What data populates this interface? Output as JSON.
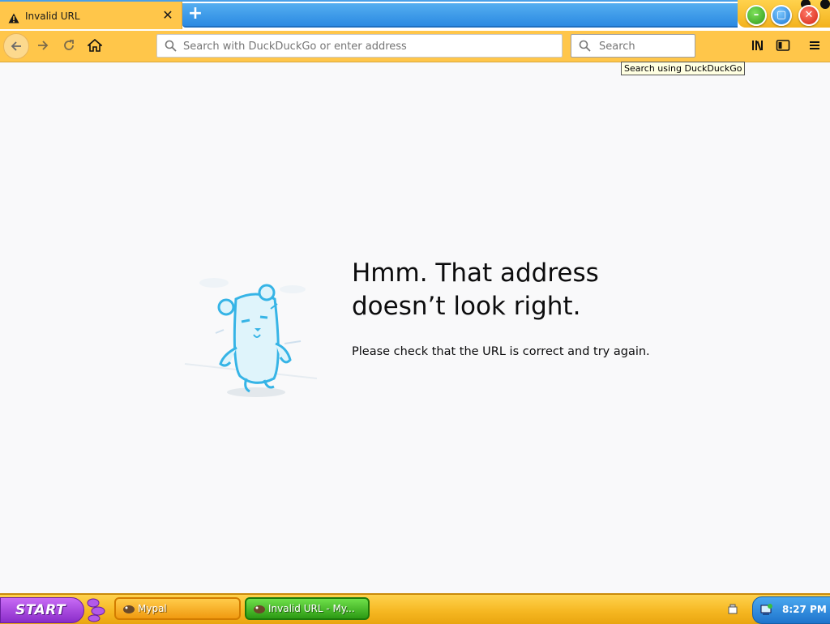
{
  "tab": {
    "title": "Invalid URL",
    "close_glyph": "✕",
    "new_tab_glyph": "+"
  },
  "navbar": {
    "url_placeholder": "Search with DuckDuckGo or enter address",
    "search_placeholder": "Search",
    "tooltip": "Search using DuckDuckGo"
  },
  "error": {
    "title": "Hmm. That address doesn’t look right.",
    "description": "Please check that the URL is correct and try again."
  },
  "taskbar": {
    "start_label": "START",
    "tasks": [
      {
        "label": "Mypal"
      },
      {
        "label": "Invalid URL - My..."
      }
    ],
    "clock": "8:27 PM"
  },
  "colors": {
    "toolbar": "#ffc64a",
    "tab_blue": "#2b8ae2",
    "start_purple": "#8a2cc9",
    "task_active_green": "#2c9a14",
    "clock_blue": "#1e74cc"
  },
  "icons": [
    "warning-icon",
    "back-arrow-icon",
    "forward-arrow-icon",
    "reload-icon",
    "home-icon",
    "search-icon",
    "library-icon",
    "sidebar-icon",
    "hamburger-menu-icon",
    "hamster-illustration",
    "minimize-icon",
    "maximize-icon",
    "close-icon"
  ]
}
